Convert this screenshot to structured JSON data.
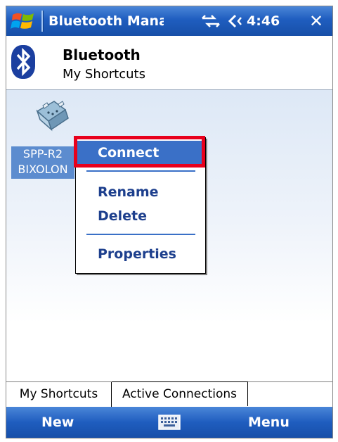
{
  "titlebar": {
    "title": "Bluetooth Mana",
    "time": "4:46",
    "close_label": "✕",
    "icons": [
      "windows-start-icon",
      "connectivity-icon",
      "volume-icon"
    ]
  },
  "header": {
    "title": "Bluetooth",
    "subtitle": "My Shortcuts",
    "icon": "bluetooth-icon"
  },
  "device": {
    "icon": "serial-port-icon",
    "line1": "SPP-R2",
    "line2": "BIXOLON"
  },
  "context_menu": {
    "items": [
      {
        "label": "Connect",
        "selected": true
      },
      {
        "label": "Rename",
        "selected": false
      },
      {
        "label": "Delete",
        "selected": false
      },
      {
        "label": "Properties",
        "selected": false
      }
    ],
    "highlight_color": "#e8001c"
  },
  "tabs": [
    {
      "label": "My Shortcuts",
      "active": true
    },
    {
      "label": "Active Connections",
      "active": false
    }
  ],
  "softkeys": {
    "left": "New",
    "right": "Menu",
    "center_icon": "keyboard-icon"
  },
  "colors": {
    "titlebar_blue": "#1f5dbf",
    "menu_text": "#1d3f8d",
    "selection": "#3a70c7",
    "device_label_bg": "#5c8ccf"
  }
}
